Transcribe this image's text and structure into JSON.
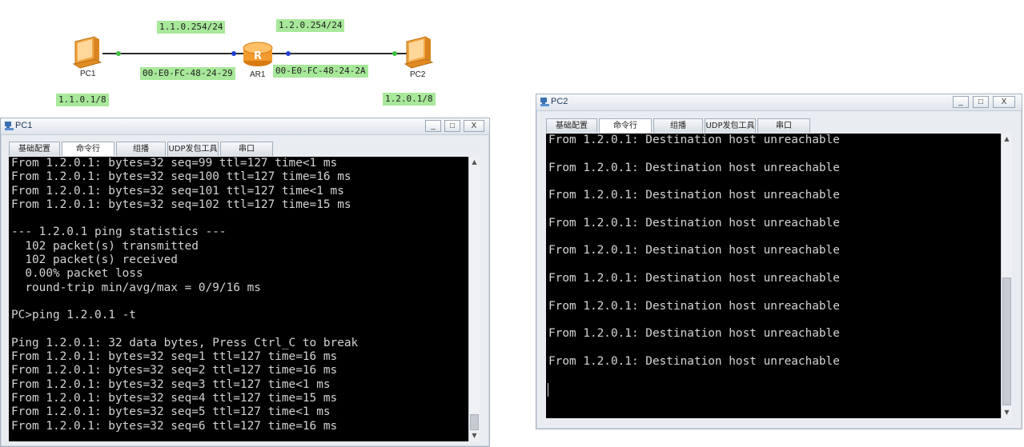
{
  "topology": {
    "pc1": {
      "name": "PC1",
      "ip": "1.1.0.1/8"
    },
    "pc2": {
      "name": "PC2",
      "ip": "1.2.0.1/8"
    },
    "ar1": {
      "name": "AR1",
      "if_left_ip": "1.1.0.254/24",
      "if_right_ip": "1.2.0.254/24",
      "mac_left": "00-E0-FC-48-24-29",
      "mac_right": "00-E0-FC-48-24-2A"
    },
    "colors": {
      "label_bg": "#a8e89a",
      "router": "#f39a2e",
      "port_green": "#3fbf3f",
      "port_blue": "#1f3fd6"
    }
  },
  "pc1_window": {
    "title": "PC1",
    "controls": {
      "minimize": "_",
      "maximize": "□",
      "close": "X"
    },
    "tabs": [
      "基础配置",
      "命令行",
      "组播",
      "UDP发包工具",
      "串口"
    ],
    "active_tab": 1,
    "console_lines": [
      "From 1.2.0.1: bytes=32 seq=99 ttl=127 time<1 ms",
      "From 1.2.0.1: bytes=32 seq=100 ttl=127 time=16 ms",
      "From 1.2.0.1: bytes=32 seq=101 ttl=127 time<1 ms",
      "From 1.2.0.1: bytes=32 seq=102 ttl=127 time=15 ms",
      "",
      "--- 1.2.0.1 ping statistics ---",
      "  102 packet(s) transmitted",
      "  102 packet(s) received",
      "  0.00% packet loss",
      "  round-trip min/avg/max = 0/9/16 ms",
      "",
      "PC>ping 1.2.0.1 -t",
      "",
      "Ping 1.2.0.1: 32 data bytes, Press Ctrl_C to break",
      "From 1.2.0.1: bytes=32 seq=1 ttl=127 time=16 ms",
      "From 1.2.0.1: bytes=32 seq=2 ttl=127 time=16 ms",
      "From 1.2.0.1: bytes=32 seq=3 ttl=127 time<1 ms",
      "From 1.2.0.1: bytes=32 seq=4 ttl=127 time=15 ms",
      "From 1.2.0.1: bytes=32 seq=5 ttl=127 time<1 ms",
      "From 1.2.0.1: bytes=32 seq=6 ttl=127 time=16 ms"
    ]
  },
  "pc2_window": {
    "title": "PC2",
    "controls": {
      "minimize": "_",
      "maximize": "□",
      "close": "X"
    },
    "tabs": [
      "基础配置",
      "命令行",
      "组播",
      "UDP发包工具",
      "串口"
    ],
    "active_tab": 1,
    "console_lines": [
      "From 1.2.0.1: Destination host unreachable",
      "",
      "From 1.2.0.1: Destination host unreachable",
      "",
      "From 1.2.0.1: Destination host unreachable",
      "",
      "From 1.2.0.1: Destination host unreachable",
      "",
      "From 1.2.0.1: Destination host unreachable",
      "",
      "From 1.2.0.1: Destination host unreachable",
      "",
      "From 1.2.0.1: Destination host unreachable",
      "",
      "From 1.2.0.1: Destination host unreachable",
      "",
      "From 1.2.0.1: Destination host unreachable"
    ]
  }
}
